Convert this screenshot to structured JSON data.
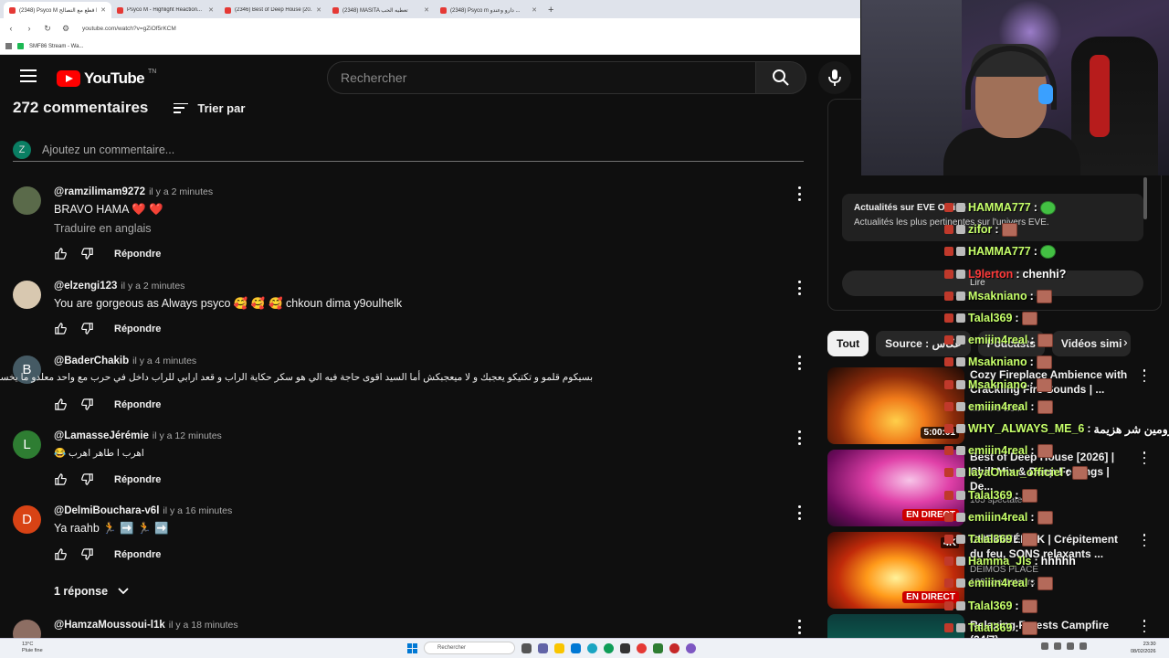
{
  "browser": {
    "tabs": [
      {
        "label": "(2348) Psyco M قطع مع التصالح Ro..."
      },
      {
        "label": "Psyco M - Highlight Reaction..."
      },
      {
        "label": "(2346) Best of Deep House [20..."
      },
      {
        "label": "(2348) MASITA تعطيه الحب"
      },
      {
        "label": "(2348) Psyco m دارو وعندو ..."
      }
    ],
    "url": "youtube.com/watch?v=gZiOf5rKCM",
    "bookmark": "SMF86 Stream - Wa..."
  },
  "youtube": {
    "logo_text": "YouTube",
    "logo_country": "TN",
    "search_placeholder": "Rechercher"
  },
  "comments_section": {
    "count_label": "272 commentaires",
    "sort_label": "Trier par",
    "add_comment_placeholder": "Ajoutez un commentaire...",
    "my_avatar_letter": "Z",
    "reply_label": "Répondre",
    "comments": [
      {
        "author": "@ramzilimam9272",
        "time": "il y a 2 minutes",
        "text": "BRAVO HAMA ❤️ ❤️",
        "translate": "Traduire en anglais",
        "avatar_letter": "",
        "avatar_color": "#5a6a4a"
      },
      {
        "author": "@elzengi123",
        "time": "il y a 2 minutes",
        "text": "You are gorgeous as Always psyco 🥰 🥰 🥰 chkoun dima y9oulhelk",
        "avatar_letter": "",
        "avatar_color": "#c8b8a0"
      },
      {
        "author": "@BaderChakib",
        "time": "il y a 4 minutes",
        "text": "بسيكوم قلمو و تكتيكو يعجبك و لا ميعجبكش أما السيد اقوى حاجة فيه الي هو سكر حكاية الراب و قعد ارابي للراب داخل في حرب مع واحد معلدو ما يخسر",
        "avatar_letter": "B",
        "avatar_color": "#455a64"
      },
      {
        "author": "@LamasseJérémie",
        "time": "il y a 12 minutes",
        "text": "😂 اهرب ا طاهر اهرب",
        "avatar_letter": "L",
        "avatar_color": "#2e7d32"
      },
      {
        "author": "@DelmiBouchara-v6l",
        "time": "il y a 16 minutes",
        "text": "Ya raahb 🏃 ➡️ 🏃 ➡️",
        "avatar_letter": "D",
        "avatar_color": "#d84315"
      },
      {
        "author": "@HamzaMoussoui-l1k",
        "time": "il y a 18 minutes",
        "avatar_letter": "",
        "avatar_color": "#8d6e63"
      }
    ],
    "replies_label": "1 réponse"
  },
  "right_panel": {
    "news_title": "Actualités sur EVE Online",
    "news_sub": "Actualités les plus pertinentes sur l'univers EVE.",
    "button_label": "Lire",
    "chips": [
      {
        "label": "Tout",
        "selected": true
      },
      {
        "label": "Source : عكاس",
        "selected": false
      },
      {
        "label": "Podcasts",
        "selected": false
      },
      {
        "label": "Vidéos simi",
        "selected": false
      }
    ],
    "videos": [
      {
        "title": "Cozy Fireplace Ambience with Crackling Fire Sounds | ...",
        "channel": "Lumora Soul",
        "meta": "",
        "badge": "5:00:01",
        "live": false,
        "thumb": "fire"
      },
      {
        "title": "Best of Deep House [2026] | Chill Mix & Deep Feelings | De...",
        "channel": "",
        "meta": "165 spectateurs",
        "badge": "EN DIRECT",
        "live": true,
        "thumb": "house"
      },
      {
        "title": "CHEMINÉE 4K | Crépitement du feu, SONS relaxants ...",
        "channel": "DEIMOS PLACE",
        "meta": "100 spectateurs",
        "badge": "EN DIRECT",
        "live": true,
        "thumb": "fire2",
        "badge4k": "4K"
      },
      {
        "title": "Relaxing Forests Campfire (24/7)",
        "channel": "",
        "meta": "",
        "badge": "",
        "live": false,
        "thumb": "camp"
      }
    ]
  },
  "chat": {
    "messages": [
      {
        "user": "HAMMA777",
        "text": "",
        "emote": "green",
        "red": false
      },
      {
        "user": "zifor",
        "text": "",
        "emote": "face",
        "red": false
      },
      {
        "user": "HAMMA777",
        "text": "",
        "emote": "green",
        "red": false
      },
      {
        "user": "L9lerton",
        "text": "chenhi?",
        "emote": "",
        "red": true
      },
      {
        "user": "Msakniano",
        "text": "",
        "emote": "face",
        "red": false
      },
      {
        "user": "Talal369",
        "text": "",
        "emote": "face",
        "red": false
      },
      {
        "user": "emiiin4real",
        "text": "",
        "emote": "face",
        "red": false
      },
      {
        "user": "Msakniano",
        "text": "",
        "emote": "face",
        "red": false
      },
      {
        "user": "Msakniano",
        "text": "",
        "emote": "face",
        "red": false
      },
      {
        "user": "emiiin4real",
        "text": "",
        "emote": "face",
        "red": false
      },
      {
        "user": "WHY_ALWAYS_ME_6",
        "text": "الشبابزيون مهزومين شر هزيمة",
        "emote": "",
        "red": false
      },
      {
        "user": "emiiin4real",
        "text": "",
        "emote": "face",
        "red": false
      },
      {
        "user": "layaOmar_officiel",
        "text": "",
        "emote": "face",
        "red": false
      },
      {
        "user": "Talal369",
        "text": "",
        "emote": "face",
        "red": false
      },
      {
        "user": "emiiin4real",
        "text": "",
        "emote": "face",
        "red": false
      },
      {
        "user": "Talal369",
        "text": "",
        "emote": "face",
        "red": false
      },
      {
        "user": "Hamma_Jls",
        "text": "hhhhh",
        "emote": "",
        "red": false
      },
      {
        "user": "emiiin4real",
        "text": "",
        "emote": "face",
        "red": false
      },
      {
        "user": "Talal369",
        "text": "",
        "emote": "face",
        "red": false
      },
      {
        "user": "Talal369",
        "text": "",
        "emote": "face",
        "red": false
      }
    ]
  },
  "taskbar": {
    "weather_temp": "13°C",
    "weather_desc": "Pluie fine",
    "search_label": "Rechercher",
    "time": "23:30",
    "date": "08/02/2026"
  },
  "colors": {
    "bg": "#0f0f0f",
    "yt_red": "#ff0000",
    "chat_user": "#c6ff6a",
    "live_red": "#cc0000"
  }
}
